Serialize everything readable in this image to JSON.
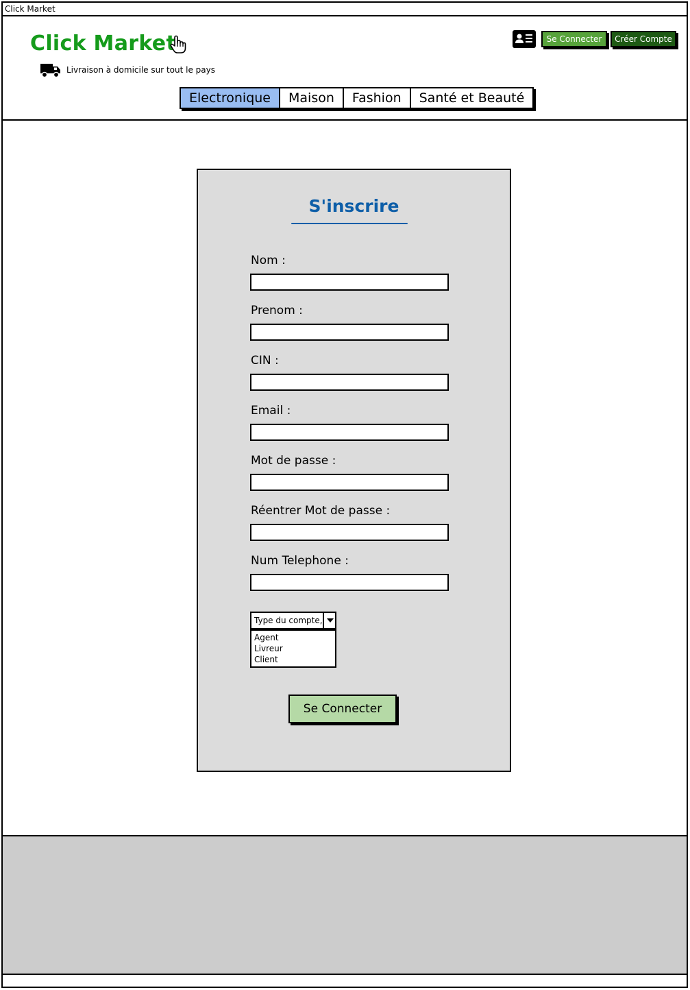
{
  "window": {
    "title": "Click Market"
  },
  "header": {
    "logo": "Click Market",
    "delivery_text": "Livraison à domicile sur tout le pays",
    "icons": {
      "pointer": "hand-pointer-icon",
      "delivery": "truck-icon",
      "account": "id-card-icon"
    },
    "login_label": "Se Connecter",
    "create_account_label": "Créer Compte",
    "colors": {
      "brand": "#159b1b",
      "login_button": "#57a33b",
      "create_button": "#1e5a14"
    }
  },
  "nav": {
    "tabs": [
      {
        "label": "Electronique",
        "active": true
      },
      {
        "label": "Maison",
        "active": false
      },
      {
        "label": "Fashion",
        "active": false
      },
      {
        "label": "Santé et Beauté",
        "active": false
      }
    ],
    "active_color": "#99bdf2"
  },
  "form": {
    "title": "S'inscrire",
    "fields": [
      {
        "label": "Nom :",
        "value": ""
      },
      {
        "label": "Prenom :",
        "value": ""
      },
      {
        "label": "CIN :",
        "value": ""
      },
      {
        "label": "Email :",
        "value": ""
      },
      {
        "label": "Mot de passe :",
        "value": ""
      },
      {
        "label": "Réentrer Mot de passe :",
        "value": ""
      },
      {
        "label": "Num Telephone :",
        "value": ""
      }
    ],
    "account_type": {
      "selected": "Type du compte,",
      "options": [
        "Agent",
        "Livreur",
        "Client"
      ]
    },
    "submit_label": "Se Connecter",
    "colors": {
      "title": "#0d5ea8",
      "panel": "#dcdcdc",
      "submit": "#b5d9a6"
    }
  }
}
